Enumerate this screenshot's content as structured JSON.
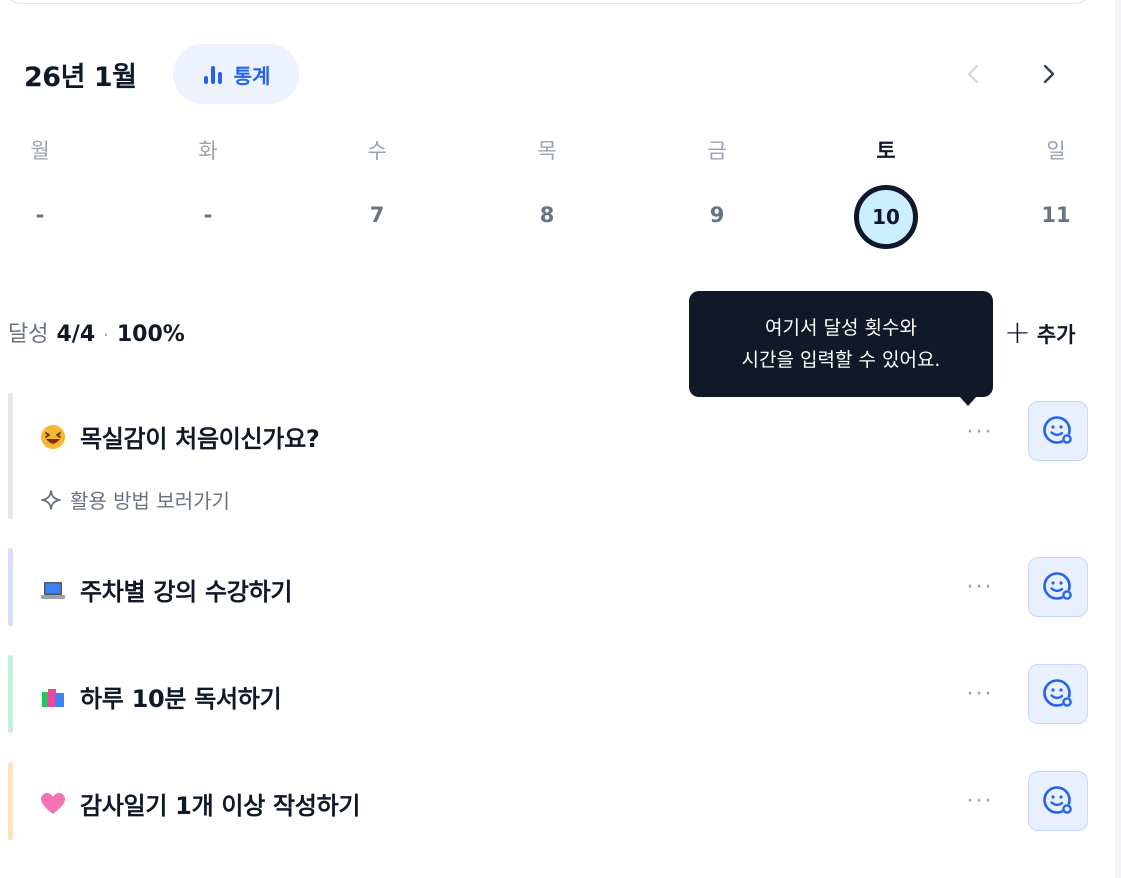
{
  "header": {
    "month_title": "26년 1월",
    "stats_label": "통계"
  },
  "week": {
    "weekdays": [
      "월",
      "화",
      "수",
      "목",
      "금",
      "토",
      "일"
    ],
    "dates": [
      "-",
      "-",
      "7",
      "8",
      "9",
      "10",
      "11"
    ],
    "selected_index": 5
  },
  "summary": {
    "label": "달성",
    "count": "4/4",
    "separator": "·",
    "percent": "100%"
  },
  "add_label": "추가",
  "tooltip": {
    "line1": "여기서 달성 횟수와",
    "line2": "시간을 입력할 수 있어요."
  },
  "habits": [
    {
      "title": "목실감이 처음이신가요?",
      "icon": "laughing-face-emoji",
      "bar_color": "#e5e7eb",
      "more": "···",
      "link": "활용 방법 보러가기"
    },
    {
      "title": "주차별 강의 수강하기",
      "icon": "laptop-emoji",
      "bar_color": "#d6e0f5",
      "more": "···"
    },
    {
      "title": "하루 10분 독서하기",
      "icon": "books-emoji",
      "bar_color": "#c9f0dc",
      "more": "···"
    },
    {
      "title": "감사일기 1개 이상 작성하기",
      "icon": "pink-heart-emoji",
      "bar_color": "#fde3c4",
      "more": "···"
    }
  ],
  "colors": {
    "accent": "#2563eb",
    "tooltip_bg": "#111827",
    "today_fill": "#ccefff"
  }
}
